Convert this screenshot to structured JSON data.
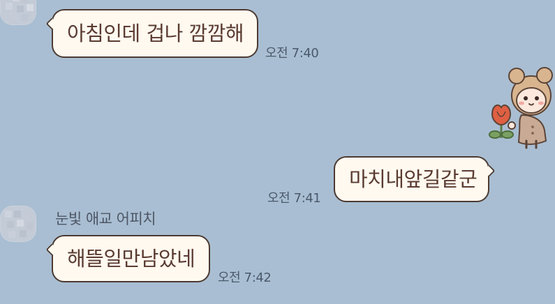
{
  "messages": [
    {
      "side": "left",
      "text": "아침인데 겁나 깜깜해",
      "time": "오전 7:40"
    },
    {
      "side": "right",
      "text": "마치내앞길같군",
      "time": "오전 7:41"
    },
    {
      "side": "left",
      "sender": "눈빛 애교 어피치",
      "text": "해뜰일만남았네",
      "time": "오전 7:42"
    }
  ],
  "colors": {
    "chat_background": "#a9bed2",
    "bubble_fill": "#fff9f0",
    "bubble_border": "#4b3a32",
    "bubble_text": "#5a3b31"
  },
  "icons": {
    "avatar": "blurred-profile-avatar",
    "decoration": "girl-with-bear-ears-holding-flower-icon"
  }
}
